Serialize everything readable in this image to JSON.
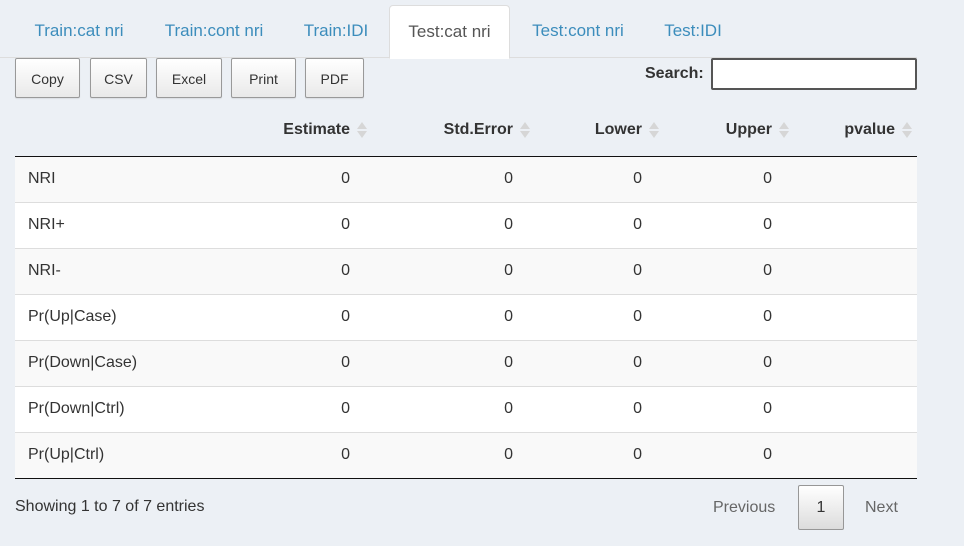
{
  "tabs": [
    {
      "label": "Train:cat nri"
    },
    {
      "label": "Train:cont nri"
    },
    {
      "label": "Train:IDI"
    },
    {
      "label": "Test:cat nri"
    },
    {
      "label": "Test:cont nri"
    },
    {
      "label": "Test:IDI"
    }
  ],
  "active_tab": "Test:cat nri",
  "buttons": {
    "copy": "Copy",
    "csv": "CSV",
    "excel": "Excel",
    "print": "Print",
    "pdf": "PDF"
  },
  "search": {
    "label": "Search:",
    "value": ""
  },
  "table": {
    "columns": [
      "",
      "Estimate",
      "Std.Error",
      "Lower",
      "Upper",
      "pvalue"
    ],
    "rows": [
      [
        "NRI",
        "0",
        "0",
        "0",
        "0",
        ""
      ],
      [
        "NRI+",
        "0",
        "0",
        "0",
        "0",
        ""
      ],
      [
        "NRI-",
        "0",
        "0",
        "0",
        "0",
        ""
      ],
      [
        "Pr(Up|Case)",
        "0",
        "0",
        "0",
        "0",
        ""
      ],
      [
        "Pr(Down|Case)",
        "0",
        "0",
        "0",
        "0",
        ""
      ],
      [
        "Pr(Down|Ctrl)",
        "0",
        "0",
        "0",
        "0",
        ""
      ],
      [
        "Pr(Up|Ctrl)",
        "0",
        "0",
        "0",
        "0",
        ""
      ]
    ]
  },
  "footer": {
    "info": "Showing 1 to 7 of 7 entries",
    "previous": "Previous",
    "current_page": "1",
    "next": "Next"
  },
  "colors": {
    "tab_link": "#3c8dbc",
    "page_background": "#ecf0f5"
  }
}
